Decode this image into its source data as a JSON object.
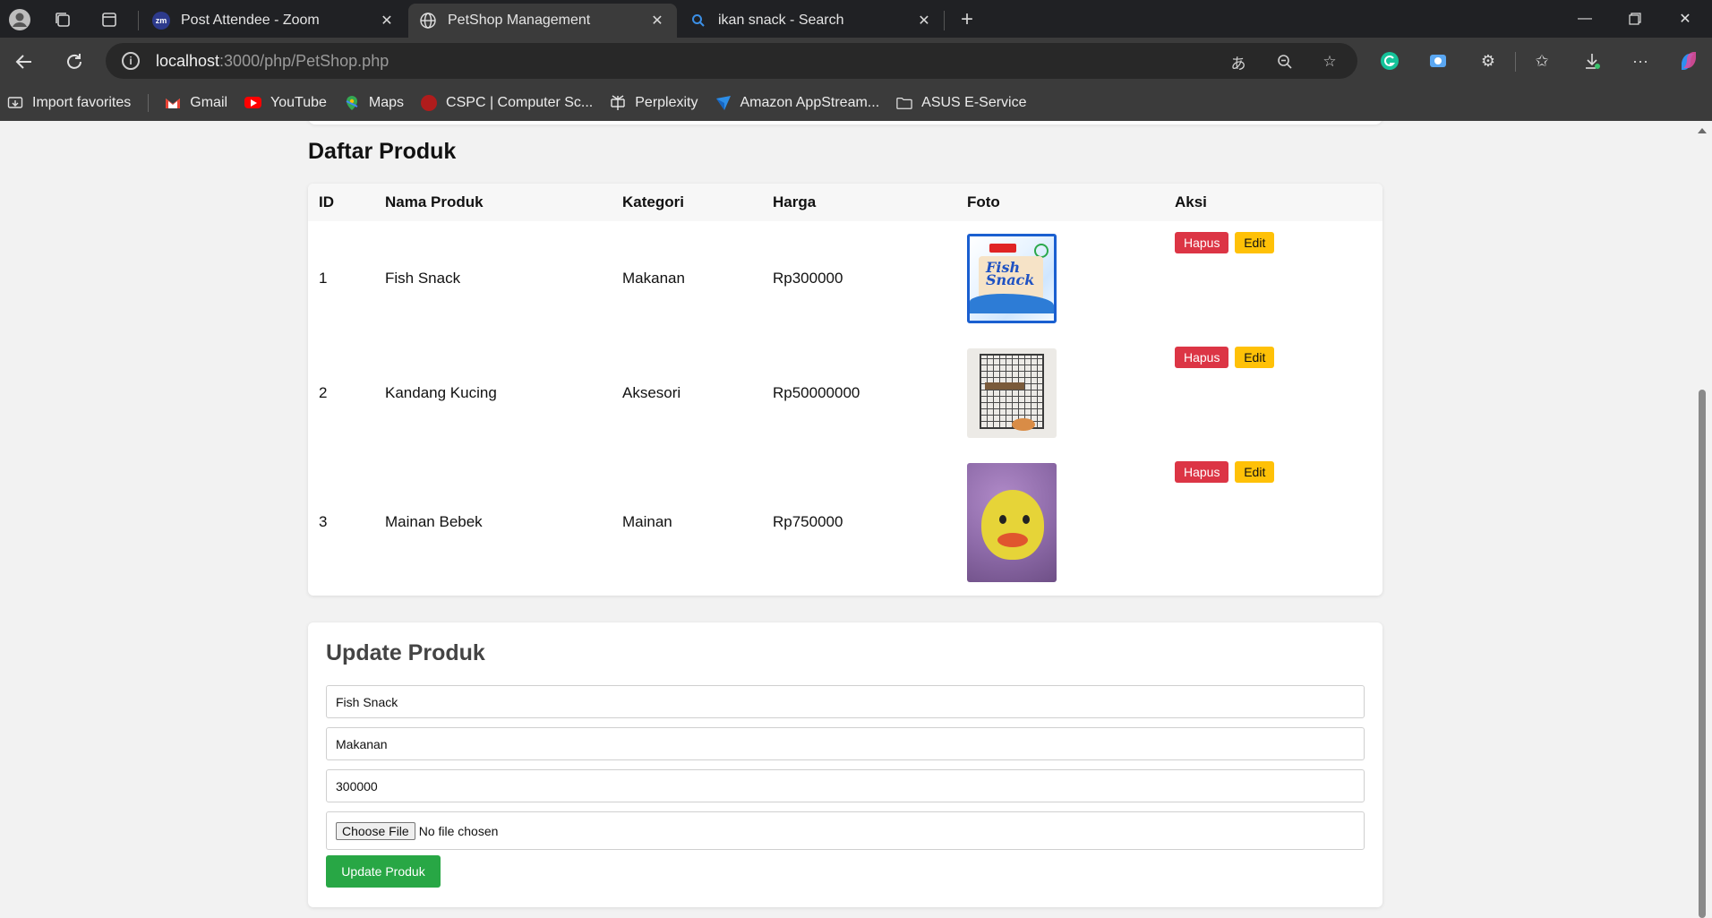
{
  "browser": {
    "tabs": [
      {
        "title": "Post Attendee - Zoom",
        "favicon": "zoom-icon",
        "favicon_text": "zm"
      },
      {
        "title": "PetShop Management",
        "favicon": "globe-icon"
      },
      {
        "title": "ikan snack - Search",
        "favicon": "search-icon"
      }
    ],
    "url_host": "localhost",
    "url_path": ":3000/php/PetShop.php",
    "bookmarks": [
      {
        "label": "Import favorites",
        "icon": "import-icon"
      },
      {
        "label": "Gmail",
        "icon": "gmail-icon"
      },
      {
        "label": "YouTube",
        "icon": "youtube-icon"
      },
      {
        "label": "Maps",
        "icon": "maps-icon"
      },
      {
        "label": "CSPC | Computer Sc...",
        "icon": "cspc-icon"
      },
      {
        "label": "Perplexity",
        "icon": "perplexity-icon"
      },
      {
        "label": "Amazon AppStream...",
        "icon": "appstream-icon"
      },
      {
        "label": "ASUS E-Service",
        "icon": "folder-icon"
      }
    ]
  },
  "products_section": {
    "title": "Daftar Produk",
    "columns": [
      "ID",
      "Nama Produk",
      "Kategori",
      "Harga",
      "Foto",
      "Aksi"
    ],
    "rows": [
      {
        "id": "1",
        "name": "Fish Snack",
        "category": "Makanan",
        "price": "Rp300000",
        "photo": "fish-snack-photo",
        "photo_text": "Fish Snack"
      },
      {
        "id": "2",
        "name": "Kandang Kucing",
        "category": "Aksesori",
        "price": "Rp50000000",
        "photo": "cat-cage-photo"
      },
      {
        "id": "3",
        "name": "Mainan Bebek",
        "category": "Mainan",
        "price": "Rp750000",
        "photo": "duck-toy-photo"
      }
    ],
    "delete_label": "Hapus",
    "edit_label": "Edit"
  },
  "update_form": {
    "title": "Update Produk",
    "name_value": "Fish Snack",
    "category_value": "Makanan",
    "price_value": "300000",
    "file_button": "Choose File",
    "file_status": "No file chosen",
    "submit_label": "Update Produk"
  },
  "colors": {
    "delete": "#dc3545",
    "edit": "#ffc107",
    "submit": "#28a745"
  }
}
